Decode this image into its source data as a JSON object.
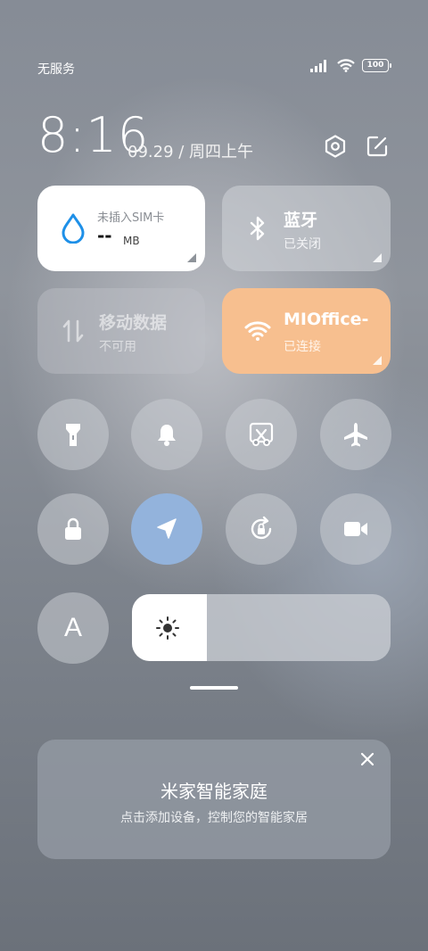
{
  "status_bar": {
    "carrier": "无服务",
    "battery": "100"
  },
  "header": {
    "time": "8:16",
    "date": "09.29 / 周四上午"
  },
  "tiles": {
    "data_usage": {
      "title": "未插入SIM卡",
      "value": "--",
      "unit": "MB"
    },
    "bluetooth": {
      "title": "蓝牙",
      "status": "已关闭"
    },
    "mobile_data": {
      "title": "移动数据",
      "status": "不可用"
    },
    "wifi": {
      "title": "MIOffice-",
      "status": "已连接",
      "color": "#f7bf8f"
    }
  },
  "toggles": {
    "auto_brightness_label": "A",
    "location_active_color": "#93b3dc"
  },
  "brightness": {
    "level": 0.29
  },
  "smart_home": {
    "title": "米家智能家庭",
    "subtitle": "点击添加设备，控制您的智能家居"
  }
}
